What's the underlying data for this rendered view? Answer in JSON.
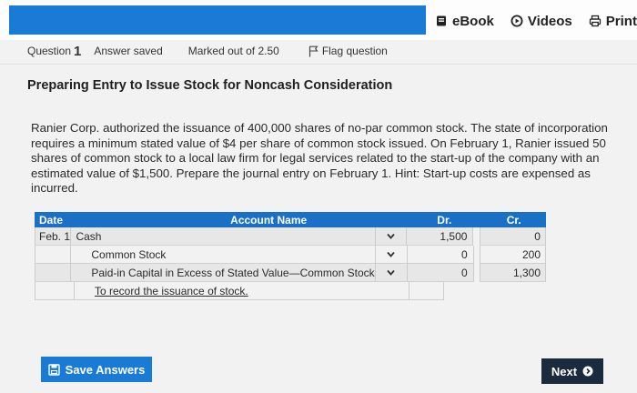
{
  "resources": {
    "ebook_label": "eBook",
    "videos_label": "Videos",
    "print_label": "Print"
  },
  "question": {
    "label": "Question",
    "number": "1",
    "status": "Answer saved",
    "marked": "Marked out of 2.50",
    "flag_label": "Flag question"
  },
  "title": "Preparing Entry to Issue Stock for Noncash Consideration",
  "problem_text": "Ranier Corp. authorized the issuance of 400,000 shares of no-par common stock. The state of incorporation requires a minimum stated value of $4 per share of common stock issued. On February 1, Ranier issued 50 shares of common stock to a local law firm for legal services related to the start-up of the company with an estimated value of $1,500. Prepare the journal entry on February 1. Hint: Start-up costs are expensed as incurred.",
  "journal": {
    "headers": {
      "date": "Date",
      "account": "Account Name",
      "dr": "Dr.",
      "cr": "Cr."
    },
    "rows": [
      {
        "date": "Feb. 1",
        "account": "Cash",
        "dr": "1,500",
        "cr": "0"
      },
      {
        "date": "",
        "account": "Common Stock",
        "dr": "0",
        "cr": "200"
      },
      {
        "date": "",
        "account": "Paid-in Capital in Excess of Stated Value—Common Stock",
        "dr": "0",
        "cr": "1,300"
      }
    ],
    "memo": "To record the issuance of stock."
  },
  "buttons": {
    "save_label": "Save Answers",
    "next_label": "Next"
  },
  "colors": {
    "accent_blue": "#1a7bd6",
    "table_header": "#1a70c6",
    "next_dark": "#1a2b3d"
  }
}
